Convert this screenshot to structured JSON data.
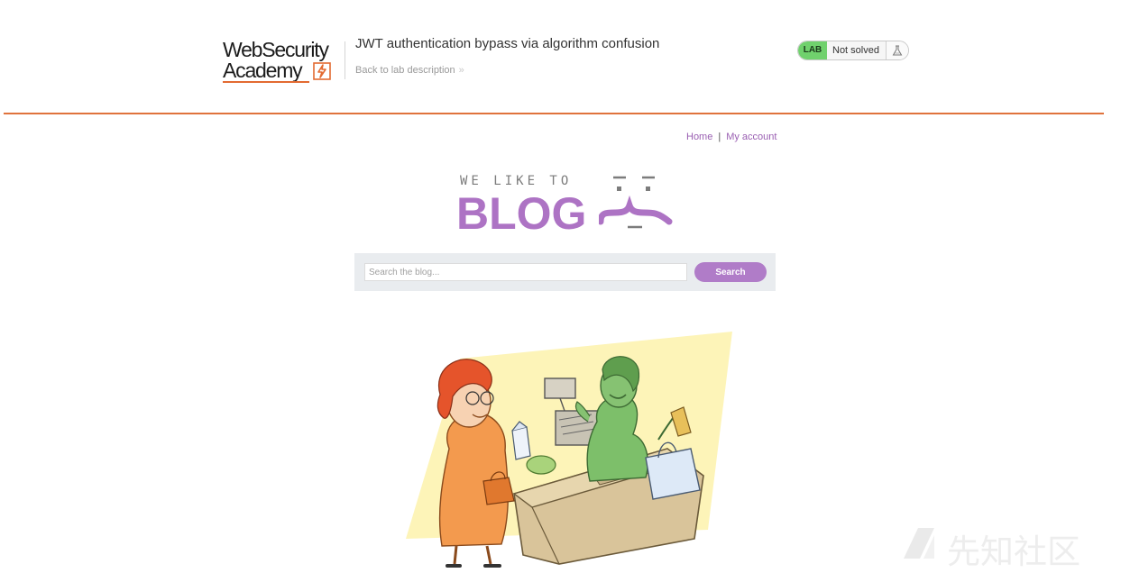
{
  "academy": {
    "logo_line1": "WebSecurity",
    "logo_line2": "Academy",
    "lab_title": "JWT authentication bypass via algorithm confusion",
    "back_link": "Back to lab description",
    "lab_badge": "LAB",
    "status": "Not solved",
    "accent_color": "#e0733c"
  },
  "blog": {
    "nav": {
      "home": "Home",
      "separator": "|",
      "my_account": "My account"
    },
    "logo": {
      "tagline": "WE LIKE TO",
      "word": "BLOG"
    },
    "search": {
      "placeholder": "Search the blog...",
      "value": "",
      "button": "Search"
    },
    "accent_color": "#ad73c4"
  },
  "watermark": {
    "text": "先知社区"
  }
}
